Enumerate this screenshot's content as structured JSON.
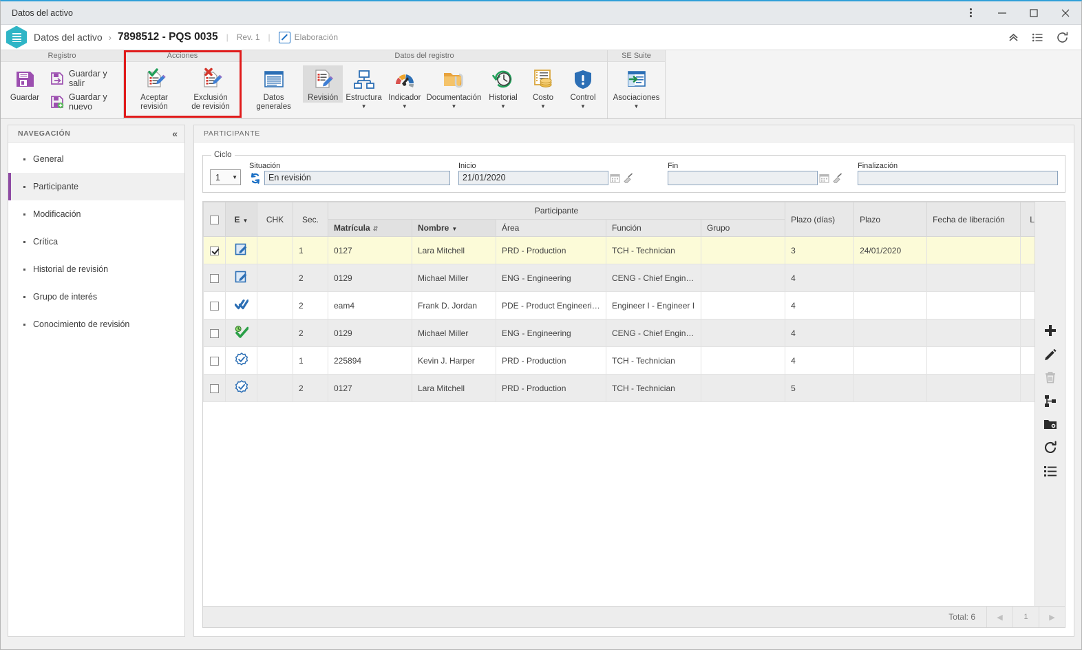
{
  "window": {
    "title": "Datos del activo",
    "controls": {
      "menu": "more-options",
      "minimize": "minimize",
      "maximize": "maximize",
      "close": "close"
    }
  },
  "header": {
    "breadcrumb_root": "Datos del activo",
    "separator": "›",
    "record_id": "7898512 - PQS 0035",
    "divider": "|",
    "revision": "Rev. 1",
    "state_label": "Elaboración",
    "right_icons": [
      "collapse-up-icon",
      "list-icon",
      "refresh-icon"
    ]
  },
  "ribbon": {
    "groups": [
      {
        "name": "Registro",
        "label": "Registro",
        "big_buttons": [
          {
            "label": "Guardar",
            "icon": "save-floppy-icon"
          }
        ],
        "small_buttons": [
          {
            "label": "Guardar y salir",
            "icon": "save-exit-icon"
          },
          {
            "label": "Guardar y nuevo",
            "icon": "save-new-icon"
          }
        ]
      },
      {
        "name": "Acciones",
        "label": "Acciones",
        "highlighted": true,
        "big_buttons": [
          {
            "label": "Aceptar revisión",
            "icon": "accept-review-icon"
          },
          {
            "label": "Exclusión de revisión",
            "icon": "exclude-review-icon"
          }
        ]
      },
      {
        "name": "Datos del registro",
        "label": "Datos del registro",
        "big_buttons": [
          {
            "label": "Datos generales",
            "icon": "general-data-icon",
            "caret": false,
            "selected": false
          },
          {
            "label": "Revisión",
            "icon": "review-icon",
            "caret": false,
            "selected": true
          },
          {
            "label": "Estructura",
            "icon": "structure-icon",
            "caret": true,
            "selected": false
          },
          {
            "label": "Indicador",
            "icon": "indicator-gauge-icon",
            "caret": true,
            "selected": false
          },
          {
            "label": "Documentación",
            "icon": "folder-attachment-icon",
            "caret": true,
            "selected": false
          },
          {
            "label": "Historial",
            "icon": "history-clock-icon",
            "caret": true,
            "selected": false
          },
          {
            "label": "Costo",
            "icon": "cost-coins-icon",
            "caret": true,
            "selected": false
          },
          {
            "label": "Control",
            "icon": "control-shield-icon",
            "caret": true,
            "selected": false
          }
        ]
      },
      {
        "name": "SE Suite",
        "label": "SE Suite",
        "big_buttons": [
          {
            "label": "Asociaciones",
            "icon": "associations-icon",
            "caret": true,
            "selected": false
          }
        ]
      }
    ]
  },
  "nav": {
    "title": "NAVEGACIÓN",
    "collapse_icon": "«",
    "items": [
      {
        "label": "General",
        "active": false
      },
      {
        "label": "Participante",
        "active": true
      },
      {
        "label": "Modificación",
        "active": false
      },
      {
        "label": "Crítica",
        "active": false
      },
      {
        "label": "Historial de revisión",
        "active": false
      },
      {
        "label": "Grupo de interés",
        "active": false
      },
      {
        "label": "Conocimiento de revisión",
        "active": false
      }
    ]
  },
  "content": {
    "title": "PARTICIPANTE",
    "ciclo": {
      "legend": "Ciclo",
      "cycle_value": "1",
      "cycle_options": [
        "1"
      ],
      "situacion_label": "Situación",
      "situacion_value": "En revisión",
      "inicio_label": "Inicio",
      "inicio_value": "21/01/2020",
      "fin_label": "Fin",
      "fin_value": "",
      "finalizacion_label": "Finalización",
      "finalizacion_value": ""
    },
    "table": {
      "group_header": "Participante",
      "columns": {
        "select": "",
        "e": "E",
        "chk": "CHK",
        "sec": "Sec.",
        "matricula": "Matrícula",
        "nombre": "Nombre",
        "area": "Área",
        "funcion": "Función",
        "grupo": "Grupo",
        "plazo_dias": "Plazo (días)",
        "plazo": "Plazo",
        "fecha_liberacion": "Fecha de liberación",
        "l": "L"
      },
      "rows": [
        {
          "selected": true,
          "status_icon": "edit-blue-icon",
          "chk": "",
          "sec": "1",
          "matricula": "0127",
          "nombre": "Lara Mitchell",
          "area": "PRD - Production",
          "funcion": "TCH - Technician",
          "grupo": "",
          "plazo_dias": "3",
          "plazo": "24/01/2020",
          "fecha_liberacion": "",
          "l": ""
        },
        {
          "selected": false,
          "status_icon": "edit-blue-icon",
          "chk": "",
          "sec": "2",
          "matricula": "0129",
          "nombre": "Michael Miller",
          "area": "ENG - Engineering",
          "funcion": "CENG - Chief Engineer",
          "grupo": "",
          "plazo_dias": "4",
          "plazo": "",
          "fecha_liberacion": "",
          "l": ""
        },
        {
          "selected": false,
          "status_icon": "double-check-blue-icon",
          "chk": "",
          "sec": "2",
          "matricula": "eam4",
          "nombre": "Frank D. Jordan",
          "area": "PDE - Product Engineering",
          "funcion": "Engineer I - Engineer I",
          "grupo": "",
          "plazo_dias": "4",
          "plazo": "",
          "fecha_liberacion": "",
          "l": ""
        },
        {
          "selected": false,
          "status_icon": "check-green-clock-icon",
          "chk": "",
          "sec": "2",
          "matricula": "0129",
          "nombre": "Michael Miller",
          "area": "ENG - Engineering",
          "funcion": "CENG - Chief Engineer",
          "grupo": "",
          "plazo_dias": "4",
          "plazo": "",
          "fecha_liberacion": "",
          "l": ""
        },
        {
          "selected": false,
          "status_icon": "badge-check-blue-icon",
          "chk": "",
          "sec": "1",
          "matricula": "225894",
          "nombre": "Kevin J. Harper",
          "area": "PRD - Production",
          "funcion": "TCH - Technician",
          "grupo": "",
          "plazo_dias": "4",
          "plazo": "",
          "fecha_liberacion": "",
          "l": ""
        },
        {
          "selected": false,
          "status_icon": "badge-check-blue-icon",
          "chk": "",
          "sec": "2",
          "matricula": "0127",
          "nombre": "Lara Mitchell",
          "area": "PRD - Production",
          "funcion": "TCH - Technician",
          "grupo": "",
          "plazo_dias": "5",
          "plazo": "",
          "fecha_liberacion": "",
          "l": ""
        }
      ],
      "footer": {
        "total_label": "Total: 6",
        "prev": "◀",
        "page": "1",
        "next": "▶"
      }
    },
    "rail_actions": [
      {
        "name": "add-icon",
        "enabled": true
      },
      {
        "name": "edit-pencil-icon",
        "enabled": true
      },
      {
        "name": "delete-trash-icon",
        "enabled": false
      },
      {
        "name": "hierarchy-icon",
        "enabled": true
      },
      {
        "name": "folder-search-icon",
        "enabled": true
      },
      {
        "name": "refresh-icon",
        "enabled": true
      },
      {
        "name": "list-detail-icon",
        "enabled": true
      }
    ]
  },
  "colors": {
    "accent_blue": "#2f9fd8",
    "brand_teal": "#2fb5c6",
    "purple": "#8e4ba3",
    "highlight_red": "#e01b1b",
    "selected_row": "#fcfbd8"
  }
}
